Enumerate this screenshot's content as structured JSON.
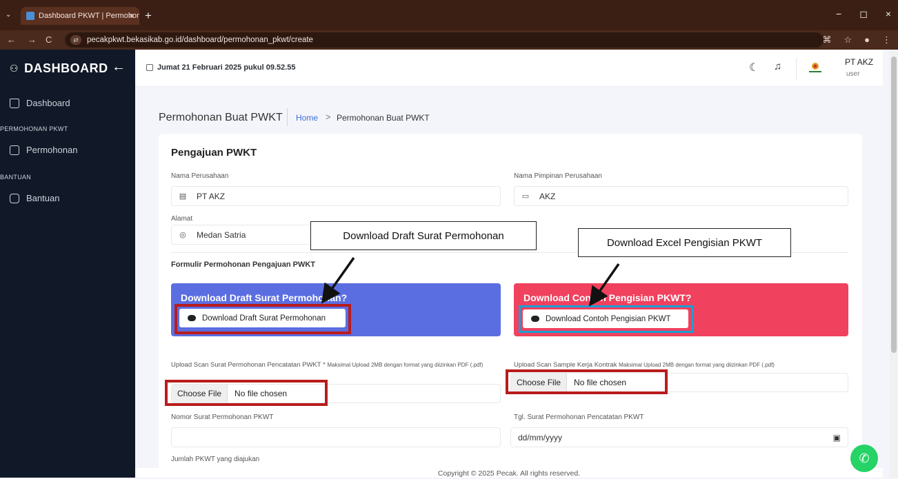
{
  "browser": {
    "tab_title": "Dashboard PKWT | Permohonan",
    "tab_close": "×",
    "tabs_menu": "⌄",
    "new_tab": "+",
    "url": "pecakpkwt.bekasikab.go.id/dashboard/permohonan_pkwt/create",
    "back": "←",
    "forward": "→",
    "reload": "C",
    "win_min": "−",
    "win_restore": "◻",
    "win_close": "×"
  },
  "sidebar": {
    "brand": "DASHBOARD",
    "back_arrow": "←",
    "items": [
      {
        "label": "Dashboard",
        "icon": "home-icon"
      },
      {
        "section": "PERMOHONAN PKWT"
      },
      {
        "label": "Permohonan",
        "icon": "archive-icon"
      },
      {
        "section": "BANTUAN"
      },
      {
        "label": "Bantuan",
        "icon": "message-icon"
      }
    ]
  },
  "topbar": {
    "datetime": "Jumat  21 Februari 2025 pukul 09.52.55",
    "user_name": "PT AKZ",
    "user_role": "user"
  },
  "breadcrumb": {
    "page_title": "Permohonan Buat PWKT",
    "home": "Home",
    "separator": ">",
    "current": "Permohonan Buat PWKT"
  },
  "form": {
    "title": "Pengajuan PWKT",
    "nama_perusahaan_label": "Nama Perusahaan",
    "nama_perusahaan_value": "PT AKZ",
    "nama_pimpinan_label": "Nama Pimpinan Perusahaan",
    "nama_pimpinan_value": "AKZ",
    "alamat_label": "Alamat",
    "alamat_value": "Medan Satria",
    "subtitle": "Formulir Permohonan Pengajuan PWKT",
    "draft_card_title": "Download Draft Surat Permohonan?",
    "draft_button": "Download Draft Surat Permohonan",
    "contoh_card_title": "Download Contoh Pengisian PKWT?",
    "contoh_button": "Download Contoh Pengisian PKWT",
    "upload1_label": "Upload Scan Surat Permohonan Pencatatan PWKT *",
    "upload1_hint": "Maksimal Upload 2MB dengan format yang diizinkan PDF (.pdf)",
    "upload2_label": "Upload Scan Sample Kerja Kontrak",
    "upload2_hint": "Maksimal Upload 2MB dengan format yang diizinkan PDF (.pdf)",
    "choose_file": "Choose File",
    "no_file": "No file chosen",
    "nomor_label": "Nomor Surat Permohonan PKWT",
    "tgl_label": "Tgl. Surat Permohonan Pencatatan PKWT",
    "tgl_placeholder": "dd/mm/yyyy",
    "jumlah_label": "Jumlah PKWT yang diajukan"
  },
  "annotations": {
    "callout_draft": "Download Draft Surat Permohonan",
    "callout_excel": "Download Excel Pengisian PKWT"
  },
  "footer": "Copyright © 2025 Pecak. All rights reserved.",
  "colors": {
    "draft_card": "#5b6ee1",
    "contoh_card": "#f0415e",
    "sidebar_bg": "#111827",
    "annotation_red": "#b91c1c",
    "annotation_blue": "#17a0d6"
  }
}
